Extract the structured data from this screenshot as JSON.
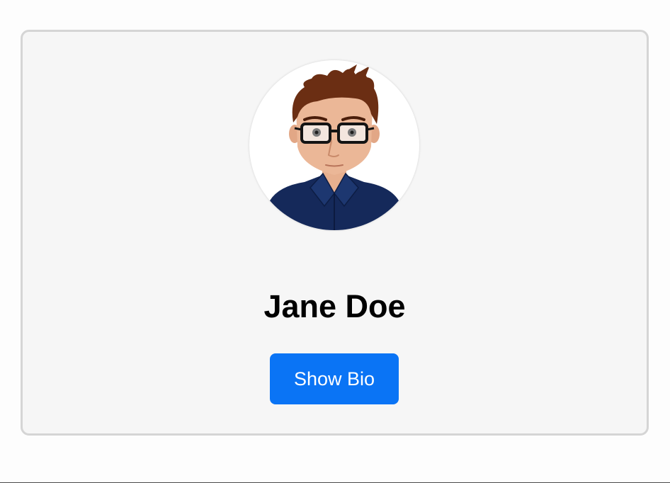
{
  "profile": {
    "name": "Jane Doe",
    "avatar_icon": "cartoon-avatar-with-glasses",
    "show_bio_label": "Show Bio"
  },
  "colors": {
    "page_background": "#fdfdfd",
    "card_background": "#f6f6f6",
    "card_border": "#d5d5d5",
    "button_background": "#0a74f5",
    "button_text": "#ffffff",
    "name_text": "#000000"
  }
}
